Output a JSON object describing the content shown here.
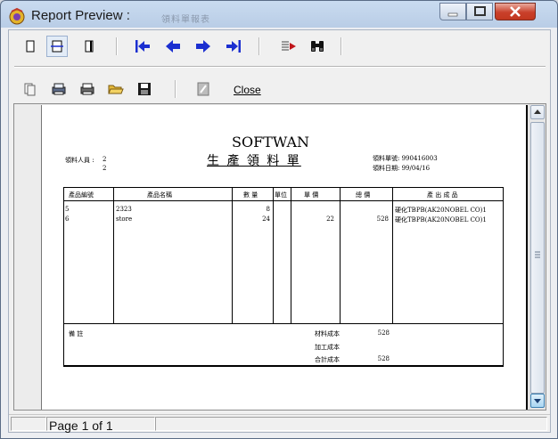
{
  "window": {
    "title": "Report Preview :",
    "ghost_title": "領料單報表"
  },
  "toolbar": {
    "close_label": "Close"
  },
  "status": {
    "page": "Page 1 of 1"
  },
  "report": {
    "company": "SOFTWAN",
    "title": "生 產 領 料 單",
    "picker_label": "領料人員 :",
    "picker_values": [
      "2",
      "2"
    ],
    "form_no": "領料單號: 990416003",
    "form_date": "領料日期: 99/04/16",
    "columns": [
      "產品編號",
      "產品名稱",
      "數 量",
      "單位",
      "單 價",
      "總 價",
      "產 出 成 品"
    ],
    "rows": [
      {
        "code": "5",
        "name": "2323",
        "qty": "8",
        "unit": "",
        "price": "",
        "total": "",
        "output": "硬化TBPB(AK20NOBEL CO)1"
      },
      {
        "code": "6",
        "name": "store",
        "qty": "24",
        "unit": "",
        "price": "22",
        "total": "528",
        "output": "硬化TBPB(AK20NOBEL CO)1"
      }
    ],
    "remark_label": "備 註",
    "material_cost_label": "材料成本",
    "material_cost": "528",
    "processing_cost_label": "加工成本",
    "total_cost_label": "合計成本",
    "total_cost": "528"
  }
}
